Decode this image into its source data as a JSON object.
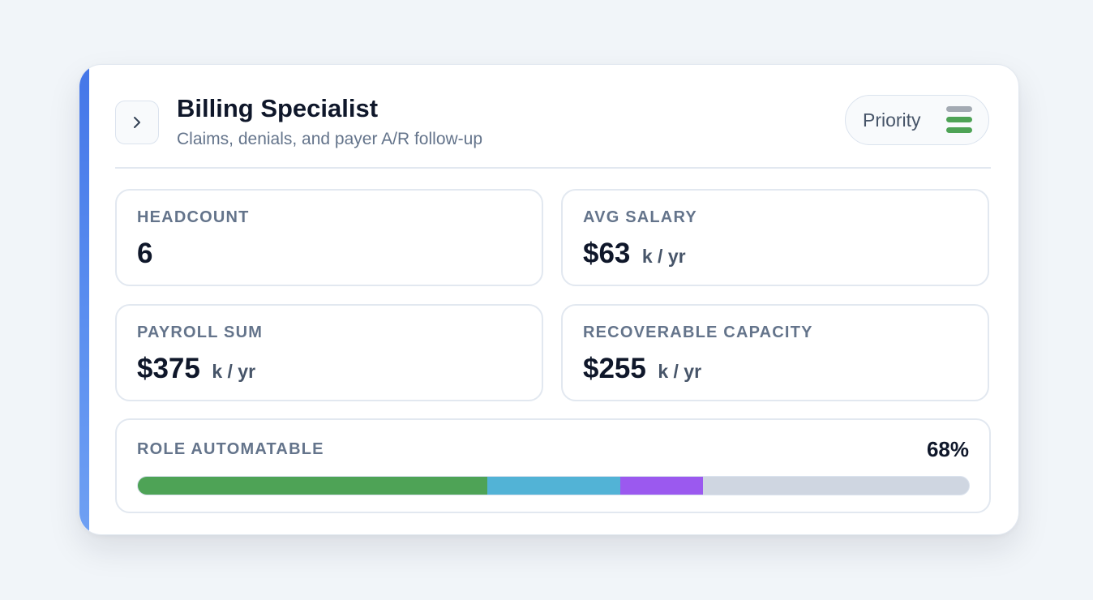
{
  "role": {
    "title": "Billing Specialist",
    "subtitle": "Claims, denials, and payer A/R follow-up"
  },
  "expand_icon": "chevron-right-icon",
  "priority": {
    "label": "Priority",
    "icon": "priority-bars-icon",
    "level": 2,
    "max": 3,
    "active_color": "#4ea356",
    "inactive_color": "#a3aab3"
  },
  "accent_color": "#4a7ceb",
  "stats": {
    "headcount": {
      "label": "HEADCOUNT",
      "value": "6",
      "unit": ""
    },
    "avg_salary": {
      "label": "AVG SALARY",
      "value": "$63",
      "unit": "k / yr"
    },
    "payroll_sum": {
      "label": "PAYROLL SUM",
      "value": "$375",
      "unit": "k / yr"
    },
    "recoverable_capacity": {
      "label": "RECOVERABLE CAPACITY",
      "value": "$255",
      "unit": "k / yr"
    }
  },
  "automatable": {
    "label": "ROLE AUTOMATABLE",
    "percent_label": "68%",
    "total_percent": 68,
    "segments": [
      {
        "percent": 42,
        "color": "#4ea356"
      },
      {
        "percent": 16,
        "color": "#52b3d6"
      },
      {
        "percent": 10,
        "color": "#9b59ef"
      }
    ],
    "track_color": "#cfd6e1"
  }
}
